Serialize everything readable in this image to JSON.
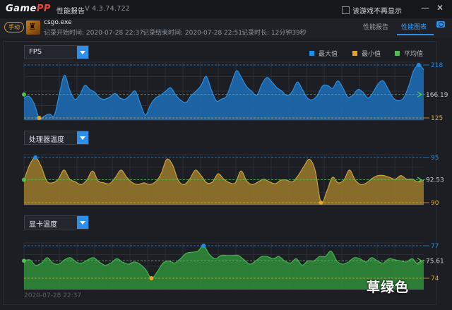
{
  "titlebar": {
    "logo_a": "Game",
    "logo_b": "PP",
    "title": "性能报告",
    "version": "V 4.3.74.722",
    "dont_show_label": "该游戏不再显示"
  },
  "info": {
    "mode": "手动",
    "game": "csgo.exe",
    "start": "记录开始时间: 2020-07-28 22:37",
    "end": "记录结束时间: 2020-07-28 22:51",
    "duration": "记录时长: 12分钟39秒"
  },
  "tabs": [
    {
      "label": "性能报告",
      "active": false
    },
    {
      "label": "性能图表",
      "active": true
    }
  ],
  "colors": {
    "max": "#1f8ee6",
    "min": "#e3a525",
    "avg": "#4cc24c",
    "fps_fill": "#1d6fb8",
    "cpu_fill": "#9a7a2c",
    "gpu_fill": "#2f8f3a"
  },
  "legend": {
    "max": "最大值",
    "min": "最小值",
    "avg": "平均值"
  },
  "footer_time": "2020-07-28 22:37",
  "watermark": "草绿色",
  "chart_data": [
    {
      "type": "area",
      "title": "FPS",
      "ylim": [
        125,
        218
      ],
      "max": 218,
      "min": 125,
      "avg": 166.19,
      "values": [
        160,
        163,
        150,
        125,
        128,
        132,
        130,
        168,
        200,
        175,
        158,
        165,
        182,
        175,
        170,
        160,
        158,
        162,
        168,
        160,
        158,
        165,
        172,
        150,
        130,
        148,
        160,
        165,
        172,
        178,
        165,
        156,
        152,
        164,
        172,
        182,
        198,
        175,
        155,
        158,
        163,
        186,
        208,
        195,
        180,
        172,
        165,
        184,
        196,
        188,
        178,
        172,
        164,
        171,
        188,
        175,
        160,
        157,
        165,
        181,
        182,
        177,
        190,
        178,
        162,
        165,
        175,
        170,
        160,
        170,
        185,
        190,
        175,
        160,
        155,
        160,
        180,
        208,
        218,
        210
      ]
    },
    {
      "type": "area",
      "title": "处理器温度",
      "ylim": [
        90,
        95
      ],
      "max": 95,
      "min": 90,
      "avg": 92.53,
      "values": [
        92.5,
        94.2,
        95,
        94,
        92.4,
        92.2,
        92.6,
        93.6,
        92.6,
        92.3,
        92,
        92.5,
        93.5,
        92.4,
        92.2,
        92.1,
        92.8,
        93.6,
        92.8,
        92.2,
        92,
        92.2,
        92,
        92.3,
        93.2,
        94.8,
        94.2,
        92.5,
        92,
        92.6,
        93.6,
        93,
        92.2,
        92.3,
        93.2,
        92.6,
        92.2,
        92.2,
        93.5,
        92.4,
        92,
        92.3,
        92.6,
        92.3,
        92.1,
        92.5,
        92.5,
        92.3,
        93,
        94,
        94.8,
        93.5,
        90,
        91.2,
        92.8,
        92.2,
        92.5,
        93.6,
        92.5,
        92,
        92.2,
        92.7,
        93,
        93,
        92.8,
        92.6,
        93,
        92.6,
        92.6,
        92.3,
        92.5
      ]
    },
    {
      "type": "area",
      "title": "显卡温度",
      "ylim": [
        74,
        77
      ],
      "max": 77,
      "min": 74,
      "avg": 75.61,
      "values": [
        75.6,
        75.7,
        75.2,
        75.4,
        75.9,
        75.4,
        75.3,
        75.7,
        75.9,
        75.5,
        75.4,
        75.7,
        75.9,
        75.5,
        75.2,
        75.4,
        75.8,
        75.5,
        75.3,
        75.5,
        75.3,
        74.8,
        74,
        74.6,
        75.4,
        75.6,
        75.4,
        75.8,
        76.3,
        76.4,
        76.5,
        77,
        76.2,
        75.8,
        76.1,
        76.1,
        76.1,
        76.1,
        75.7,
        75.3,
        75.6,
        76,
        76,
        75.8,
        76,
        75.6,
        75.4,
        75.8,
        75.2,
        75.6,
        75.6,
        76,
        76,
        76.5,
        75.6,
        75.3,
        75.5,
        75.9,
        75.8,
        75.5,
        75.9,
        75.6,
        75.4,
        75.8,
        75.7,
        75.6,
        75.5,
        75.8,
        75.3,
        75.7
      ]
    }
  ]
}
